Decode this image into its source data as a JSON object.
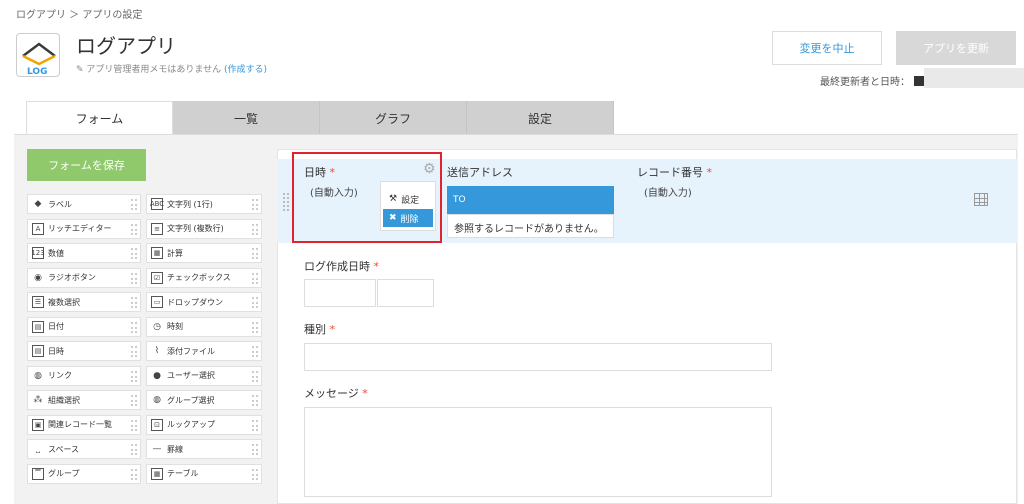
{
  "breadcrumb": "ログアプリ ＞ アプリの設定",
  "app": {
    "icon_text": "LOG",
    "title": "ログアプリ",
    "memo_text": "アプリ管理者用メモはありません",
    "memo_link": "(作成する)"
  },
  "header": {
    "cancel_label": "変更を中止",
    "update_label": "アプリを更新",
    "updated_label": "最終更新者と日時："
  },
  "tabs": [
    {
      "label": "フォーム",
      "active": true
    },
    {
      "label": "一覧",
      "active": false
    },
    {
      "label": "グラフ",
      "active": false
    },
    {
      "label": "設定",
      "active": false
    }
  ],
  "save_form_label": "フォームを保存",
  "palette": [
    {
      "label": "ラベル",
      "icon": "label-icon"
    },
    {
      "label": "文字列 (1行)",
      "icon": "text-single-icon"
    },
    {
      "label": "リッチエディター",
      "icon": "rich-editor-icon"
    },
    {
      "label": "文字列 (複数行)",
      "icon": "text-multi-icon"
    },
    {
      "label": "数値",
      "icon": "number-icon"
    },
    {
      "label": "計算",
      "icon": "calc-icon"
    },
    {
      "label": "ラジオボタン",
      "icon": "radio-icon"
    },
    {
      "label": "チェックボックス",
      "icon": "checkbox-icon"
    },
    {
      "label": "複数選択",
      "icon": "multi-select-icon"
    },
    {
      "label": "ドロップダウン",
      "icon": "dropdown-icon"
    },
    {
      "label": "日付",
      "icon": "date-icon"
    },
    {
      "label": "時刻",
      "icon": "time-icon"
    },
    {
      "label": "日時",
      "icon": "datetime-icon"
    },
    {
      "label": "添付ファイル",
      "icon": "attachment-icon"
    },
    {
      "label": "リンク",
      "icon": "link-icon"
    },
    {
      "label": "ユーザー選択",
      "icon": "user-select-icon"
    },
    {
      "label": "組織選択",
      "icon": "org-select-icon"
    },
    {
      "label": "グループ選択",
      "icon": "group-select-icon"
    },
    {
      "label": "関連レコード一覧",
      "icon": "related-records-icon"
    },
    {
      "label": "ルックアップ",
      "icon": "lookup-icon"
    },
    {
      "label": "スペース",
      "icon": "space-icon"
    },
    {
      "label": "罫線",
      "icon": "rule-icon"
    },
    {
      "label": "グループ",
      "icon": "group-icon"
    },
    {
      "label": "テーブル",
      "icon": "table-icon"
    }
  ],
  "form": {
    "datetime_label": "日時",
    "datetime_value": "(自動入力)",
    "menu_settings": "設定",
    "menu_delete": "削除",
    "sender_label": "送信アドレス",
    "to_label": "TO",
    "no_records": "参照するレコードがありません。",
    "record_no_label": "レコード番号",
    "record_no_value": "(自動入力)",
    "log_datetime_label": "ログ作成日時",
    "type_label": "種別",
    "message_label": "メッセージ",
    "required_mark": "*"
  }
}
